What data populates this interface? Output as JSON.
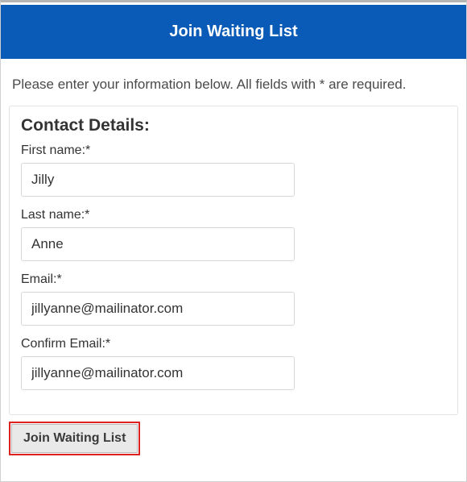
{
  "header": {
    "title": "Join Waiting List"
  },
  "instructions": "Please enter your information below. All fields with * are required.",
  "card": {
    "title": "Contact Details:",
    "fields": {
      "first_name": {
        "label": "First name:*",
        "value": "Jilly"
      },
      "last_name": {
        "label": "Last name:*",
        "value": "Anne"
      },
      "email": {
        "label": "Email:*",
        "value": "jillyanne@mailinator.com"
      },
      "confirm_email": {
        "label": "Confirm Email:*",
        "value": "jillyanne@mailinator.com"
      }
    }
  },
  "submit": {
    "label": "Join Waiting List"
  }
}
